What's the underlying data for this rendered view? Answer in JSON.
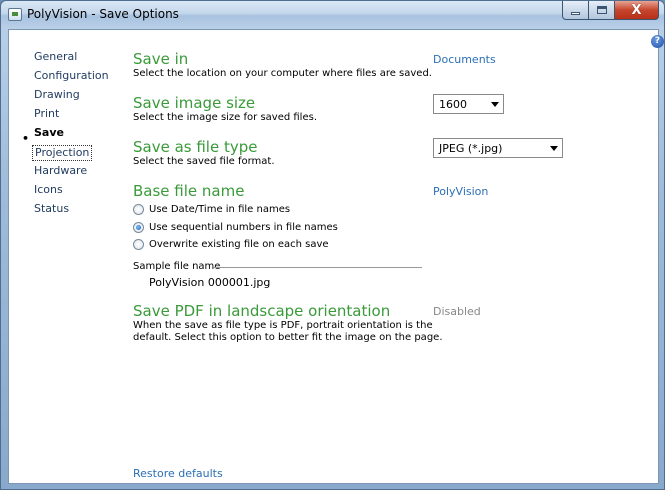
{
  "window": {
    "title": "PolyVision - Save Options"
  },
  "nav": {
    "items": [
      {
        "label": "General"
      },
      {
        "label": "Configuration"
      },
      {
        "label": "Drawing"
      },
      {
        "label": "Print"
      },
      {
        "label": "Save"
      },
      {
        "label": "Projection"
      },
      {
        "label": "Hardware"
      },
      {
        "label": "Icons"
      },
      {
        "label": "Status"
      }
    ],
    "active_marker": "•"
  },
  "sections": {
    "save_in": {
      "title": "Save in",
      "desc": "Select the location on your computer where files are saved.",
      "value": "Documents"
    },
    "image_size": {
      "title": "Save image size",
      "desc": "Select the image size for saved files.",
      "value": "1600"
    },
    "file_type": {
      "title": "Save as file type",
      "desc": "Select the saved file format.",
      "value": "JPEG (*.jpg)"
    },
    "base_name": {
      "title": "Base file name",
      "value": "PolyVision",
      "options": [
        {
          "label": "Use Date/Time in file names",
          "checked": false
        },
        {
          "label": "Use sequential numbers in file names",
          "checked": true
        },
        {
          "label": "Overwrite existing file on each save",
          "checked": false
        }
      ],
      "sample_label": "Sample file name",
      "sample_value": "PolyVision 000001.jpg"
    },
    "pdf": {
      "title": "Save PDF in landscape orientation",
      "desc_line1": "When the save as file type is PDF, portrait orientation is the",
      "desc_line2": "default. Select this option to better fit the image on the page.",
      "value": "Disabled"
    }
  },
  "footer": {
    "restore_label": "Restore defaults"
  },
  "icons": {
    "help": "?",
    "close": "X"
  }
}
